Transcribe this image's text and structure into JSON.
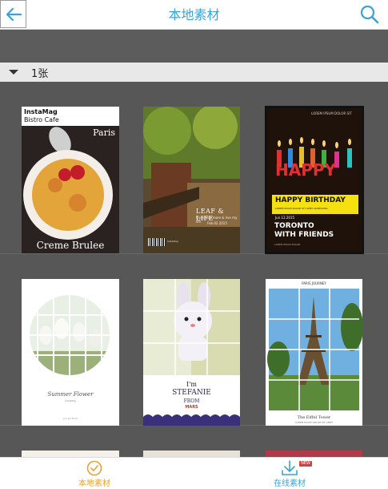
{
  "header": {
    "title": "本地素材",
    "back_icon": "arrow-left-icon",
    "search_icon": "search-icon",
    "accent_color": "#3aa3d8"
  },
  "section": {
    "count_label": "1张"
  },
  "templates": [
    {
      "brand": "InstaMag",
      "subtitle": "Bistro Cafe",
      "city": "Paris",
      "dish": "Creme Brulee"
    },
    {
      "title": "LEAF & LIFE",
      "line1": "I love you more & live my life",
      "line2": "Feb.02.2015",
      "footer": "InstaMag"
    },
    {
      "header_text": "LOREM IPSUM DOLOR SIT",
      "title": "HAPPY BIRTHDAY",
      "subtitle": "LOREM IPSUM DOLOR SIT AMET ADIPISCING",
      "date": "Jun.12.2015",
      "line1": "TORONTO",
      "line2": "WITH FRIENDS",
      "footer": "LOREM IPSUM DOLOR"
    },
    {
      "title": "Summer Flower",
      "subtitle": "InstaMag",
      "footer": "Jun.12.2015"
    },
    {
      "line1": "I'm",
      "name": "STEFANIE",
      "from": "FROM",
      "planet": "MARS"
    },
    {
      "header_text": "PARIS JOURNEY",
      "title": "The Eiffel Tower",
      "subtitle": "LOREM IPSUM DOLOR SIT AMET"
    }
  ],
  "bottom_nav": {
    "local_label": "本地素材",
    "local_icon": "check-circle-icon",
    "local_color": "#f0a030",
    "online_label": "在线素材",
    "online_icon": "download-icon",
    "new_badge": "NEW"
  }
}
